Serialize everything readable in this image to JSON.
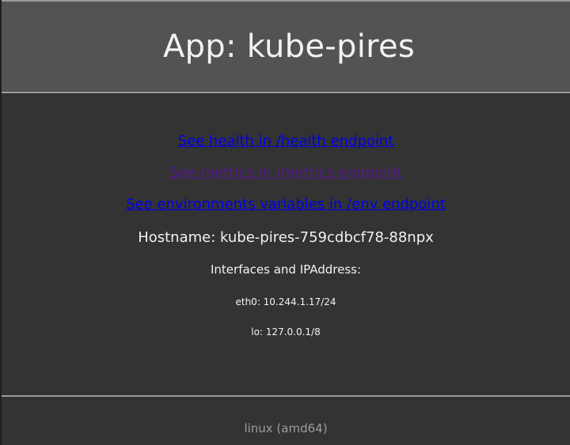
{
  "header": {
    "title": "App: kube-pires"
  },
  "links": {
    "health": "See health in /health endpoint",
    "metrics": "See metrics in /metrics endpoint",
    "env": "See environments variables in /env endpoint"
  },
  "info": {
    "hostname": "Hostname: kube-pires-759cdbcf78-88npx",
    "interfaces_title": "Interfaces and IPAddress:",
    "interfaces": [
      "eth0: 10.244.1.17/24",
      "lo: 127.0.0.1/8"
    ]
  },
  "footer": {
    "platform": "linux (amd64)"
  },
  "colors": {
    "background": "#333333",
    "header": "#535353",
    "link": "#0000ee",
    "visited_link": "#551a8b",
    "text": "#f2f2f2",
    "muted_text": "#9c9c9c"
  }
}
